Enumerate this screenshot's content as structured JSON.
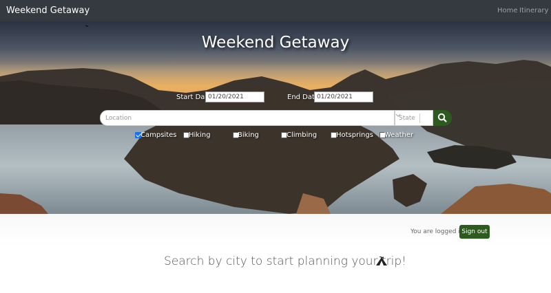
{
  "navbar": {
    "brand": "Weekend Getaway",
    "links": [
      {
        "label": "Home"
      },
      {
        "label": "Itinerary"
      }
    ],
    "background": "#343a40"
  },
  "hero": {
    "title": "Weekend Getaway",
    "start_date": {
      "label": "Start Date:",
      "value": "01/20/2021"
    },
    "end_date": {
      "label": "End Date:",
      "value": "01/20/2021"
    },
    "search": {
      "placeholder": "Location"
    },
    "state_select": {
      "placeholder": "State",
      "icon": "chevron-down-icon"
    },
    "search_button": {
      "icon": "search-icon"
    },
    "activities": [
      {
        "label": "Campsites",
        "checked": true
      },
      {
        "label": "Hiking",
        "checked": false
      },
      {
        "label": "Biking",
        "checked": false
      },
      {
        "label": "Climbing",
        "checked": false
      },
      {
        "label": "Hotsprings",
        "checked": false
      },
      {
        "label": "Weather",
        "checked": false
      }
    ]
  },
  "main": {
    "login_status": "You are logged in!",
    "signout_label": "Sign out",
    "tagline": "Search by city to start planning your trip!",
    "tagline_icon": "tent-icon"
  },
  "colors": {
    "accent": "#2d5a1f",
    "checkbox_checked": "#1a73e8"
  }
}
